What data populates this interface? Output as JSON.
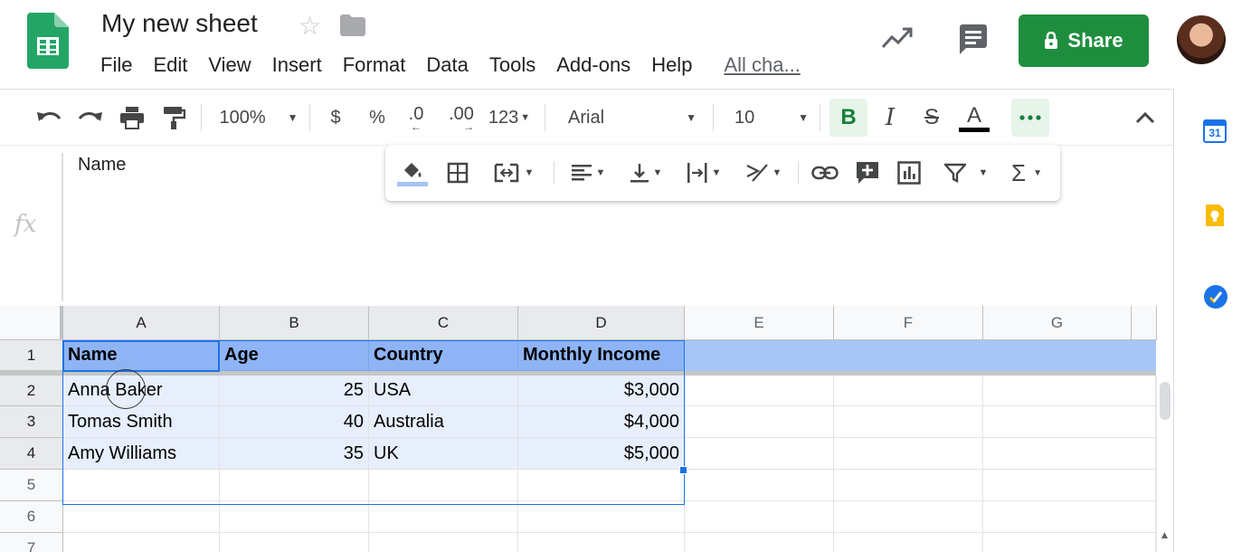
{
  "app": {
    "title": "My new sheet",
    "brand_color": "#1e8e3e",
    "accent": "#1a73e8",
    "icons": [
      "sheets-logo-icon",
      "star-icon",
      "folder-icon",
      "trending-icon",
      "comment-icon",
      "lock-icon"
    ]
  },
  "menu": {
    "items": [
      "File",
      "Edit",
      "View",
      "Insert",
      "Format",
      "Data",
      "Tools",
      "Add-ons",
      "Help"
    ],
    "last_edit": "All cha..."
  },
  "share": {
    "label": "Share"
  },
  "toolbar": {
    "zoom": "100%",
    "currency": "$",
    "percent": "%",
    "decrease_decimal": ".0",
    "increase_decimal": ".00",
    "more_formats": "123",
    "font": "Arial",
    "font_size": "10",
    "bold": "B",
    "italic": "I",
    "strike": "S",
    "text_color": "A"
  },
  "formula_bar": {
    "fx": "fx",
    "value": "Name"
  },
  "grid": {
    "columns": [
      "A",
      "B",
      "C",
      "D",
      "E",
      "F",
      "G"
    ],
    "rows": [
      "1",
      "2",
      "3",
      "4",
      "5",
      "6",
      "7"
    ],
    "header_row": [
      "Name",
      "Age",
      "Country",
      "Monthly Income"
    ],
    "data": [
      [
        "Anna Baker",
        "25",
        "USA",
        "$3,000"
      ],
      [
        "Tomas Smith",
        "40",
        "Australia",
        "$4,000"
      ],
      [
        "Amy Williams",
        "35",
        "UK",
        "$5,000"
      ]
    ]
  },
  "side_panel": {
    "calendar_day": "31",
    "icons": [
      "calendar-icon",
      "keep-icon",
      "tasks-icon"
    ]
  }
}
